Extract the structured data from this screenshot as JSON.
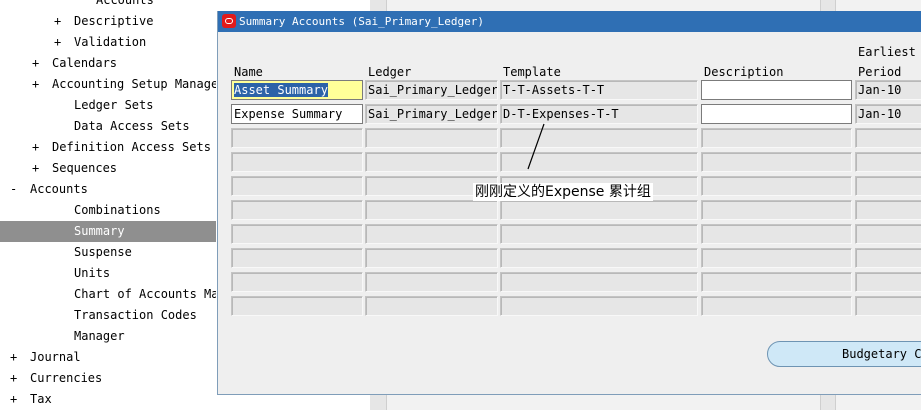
{
  "navigator": {
    "items": [
      {
        "expander": "",
        "label": "Accounts",
        "indent": 3
      },
      {
        "expander": "+",
        "label": "Descriptive",
        "indent": 2
      },
      {
        "expander": "+",
        "label": "Validation",
        "indent": 2
      },
      {
        "expander": "+",
        "label": "Calendars",
        "indent": 1
      },
      {
        "expander": "+",
        "label": "Accounting Setup Manager",
        "indent": 1
      },
      {
        "expander": "",
        "label": "Ledger Sets",
        "indent": 2
      },
      {
        "expander": "",
        "label": "Data Access Sets",
        "indent": 2
      },
      {
        "expander": "+",
        "label": "Definition Access Sets",
        "indent": 1
      },
      {
        "expander": "+",
        "label": "Sequences",
        "indent": 1
      },
      {
        "expander": "-",
        "label": "Accounts",
        "indent": 0
      },
      {
        "expander": "",
        "label": "Combinations",
        "indent": 2
      },
      {
        "expander": "",
        "label": "Summary",
        "indent": 2,
        "selected": true
      },
      {
        "expander": "",
        "label": "Suspense",
        "indent": 2
      },
      {
        "expander": "",
        "label": "Units",
        "indent": 2
      },
      {
        "expander": "",
        "label": "Chart of Accounts Mappi",
        "indent": 2
      },
      {
        "expander": "",
        "label": "Transaction Codes",
        "indent": 2
      },
      {
        "expander": "",
        "label": "Manager",
        "indent": 2
      },
      {
        "expander": "+",
        "label": "Journal",
        "indent": 0
      },
      {
        "expander": "+",
        "label": "Currencies",
        "indent": 0
      },
      {
        "expander": "+",
        "label": "Tax",
        "indent": 0
      }
    ]
  },
  "window": {
    "title": "Summary Accounts (Sai_Primary_Ledger)",
    "columns": {
      "name": "Name",
      "ledger": "Ledger",
      "template": "Template",
      "description": "Description",
      "earliest_line1": "Earliest",
      "earliest_line2": "Period"
    },
    "rows": [
      {
        "name": "Asset Summary",
        "ledger": "Sai_Primary_Ledger",
        "template": "T-T-Assets-T-T",
        "description": "",
        "period": "Jan-10"
      },
      {
        "name": "Expense Summary",
        "ledger": "Sai_Primary_Ledger",
        "template": "D-T-Expenses-T-T",
        "description": "",
        "period": "Jan-10"
      },
      {
        "name": "",
        "ledger": "",
        "template": "",
        "description": "",
        "period": ""
      },
      {
        "name": "",
        "ledger": "",
        "template": "",
        "description": "",
        "period": ""
      },
      {
        "name": "",
        "ledger": "",
        "template": "",
        "description": "",
        "period": ""
      },
      {
        "name": "",
        "ledger": "",
        "template": "",
        "description": "",
        "period": ""
      },
      {
        "name": "",
        "ledger": "",
        "template": "",
        "description": "",
        "period": ""
      },
      {
        "name": "",
        "ledger": "",
        "template": "",
        "description": "",
        "period": ""
      },
      {
        "name": "",
        "ledger": "",
        "template": "",
        "description": "",
        "period": ""
      },
      {
        "name": "",
        "ledger": "",
        "template": "",
        "description": "",
        "period": ""
      }
    ],
    "annotation": "刚刚定义的Expense 累计组",
    "budgetary_button": "Budgetary Co"
  },
  "colors": {
    "titlebar": "#2f6fb4",
    "selected_nav": "#8f8f8f",
    "active_cell": "#ffff99",
    "button": "#cfe8f7"
  }
}
